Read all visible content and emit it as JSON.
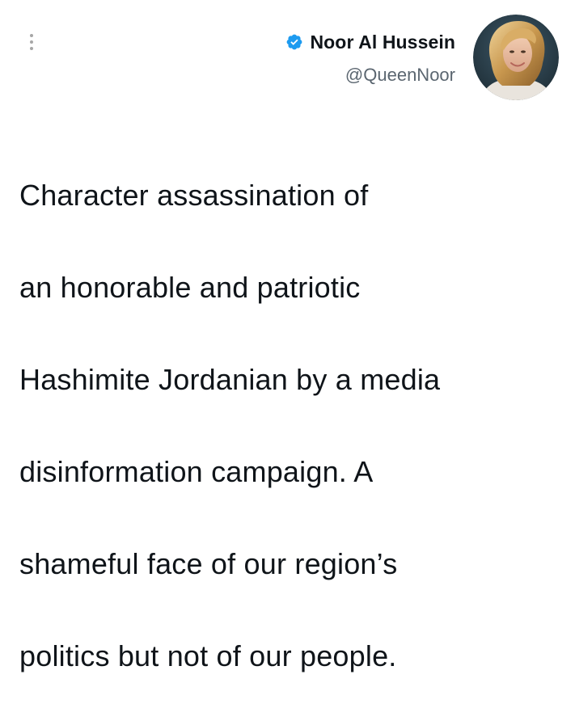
{
  "tweet": {
    "author": {
      "display_name": "Noor Al Hussein",
      "handle": "@QueenNoor",
      "verified": true,
      "verified_color": "#1d9bf0",
      "avatar_icon": "profile-photo"
    },
    "menu_icon": "more-vertical-icon",
    "text_lines": [
      "Character assassination of",
      "an honorable and patriotic",
      "Hashimite Jordanian by a media",
      "disinformation campaign. A",
      "shameful face of our region’s",
      "politics but not of our people."
    ]
  }
}
